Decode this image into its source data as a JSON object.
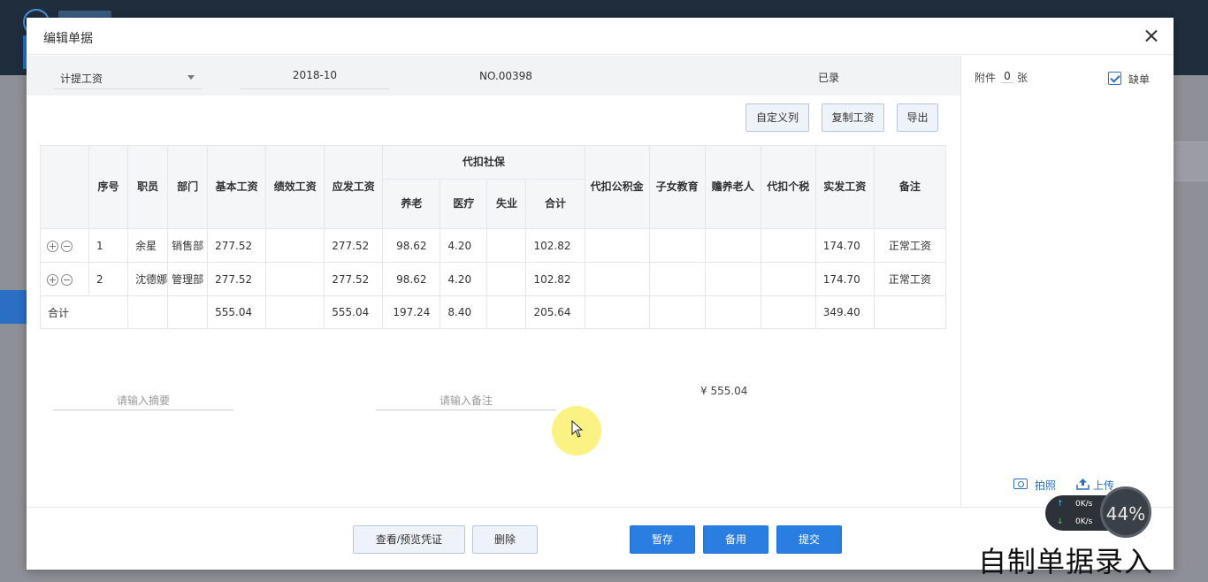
{
  "modal": {
    "title": "编辑单据"
  },
  "header_fields": {
    "type_value": "计提工资",
    "period_value": "2018-10",
    "doc_no": "NO.00398",
    "status": "已录"
  },
  "toolbar": {
    "custom_columns": "自定义列",
    "copy_salary": "复制工资",
    "export": "导出"
  },
  "table": {
    "headers": {
      "seq": "序号",
      "employee": "职员",
      "dept": "部门",
      "base": "基本工资",
      "perf": "绩效工资",
      "gross": "应发工资",
      "social_group": "代扣社保",
      "pension": "养老",
      "medical": "医疗",
      "unemployment": "失业",
      "social_total": "合计",
      "housing_fund": "代扣公积金",
      "child_edu": "子女教育",
      "elder_care": "赡养老人",
      "tax": "代扣个税",
      "net": "实发工资",
      "remark": "备注"
    },
    "rows": [
      {
        "seq": "1",
        "employee": "余星",
        "dept": "销售部",
        "base": "277.52",
        "perf": "",
        "gross": "277.52",
        "pension": "98.62",
        "medical": "4.20",
        "unemployment": "",
        "social_total": "102.82",
        "housing_fund": "",
        "child_edu": "",
        "elder_care": "",
        "tax": "",
        "net": "174.70",
        "remark": "正常工资"
      },
      {
        "seq": "2",
        "employee": "沈德娜",
        "dept": "管理部",
        "base": "277.52",
        "perf": "",
        "gross": "277.52",
        "pension": "98.62",
        "medical": "4.20",
        "unemployment": "",
        "social_total": "102.82",
        "housing_fund": "",
        "child_edu": "",
        "elder_care": "",
        "tax": "",
        "net": "174.70",
        "remark": "正常工资"
      }
    ],
    "summary": {
      "label": "合计",
      "base": "555.04",
      "gross": "555.04",
      "pension": "197.24",
      "medical": "8.40",
      "social_total": "205.64",
      "net": "349.40"
    }
  },
  "inputs": {
    "summary_placeholder": "请输入摘要",
    "remark_placeholder": "请输入备注"
  },
  "total_amount": "¥ 555.04",
  "side": {
    "attach_label": "附件",
    "attach_count": "0",
    "attach_unit": "张",
    "missing_label": "缺单",
    "missing_checked": true,
    "photo_label": "拍照",
    "upload_label": "上传"
  },
  "footer": {
    "view_voucher": "查看/预览凭证",
    "delete": "删除",
    "save_draft": "暂存",
    "standby": "备用",
    "submit": "提交"
  },
  "speed_widget": {
    "up": "0K/s",
    "down": "0K/s",
    "percent": "44%"
  },
  "caption": "自制单据录入",
  "colors": {
    "primary": "#2a7de1",
    "accent_border": "#b6c7dd",
    "header_bg": "#f5f6f8"
  }
}
